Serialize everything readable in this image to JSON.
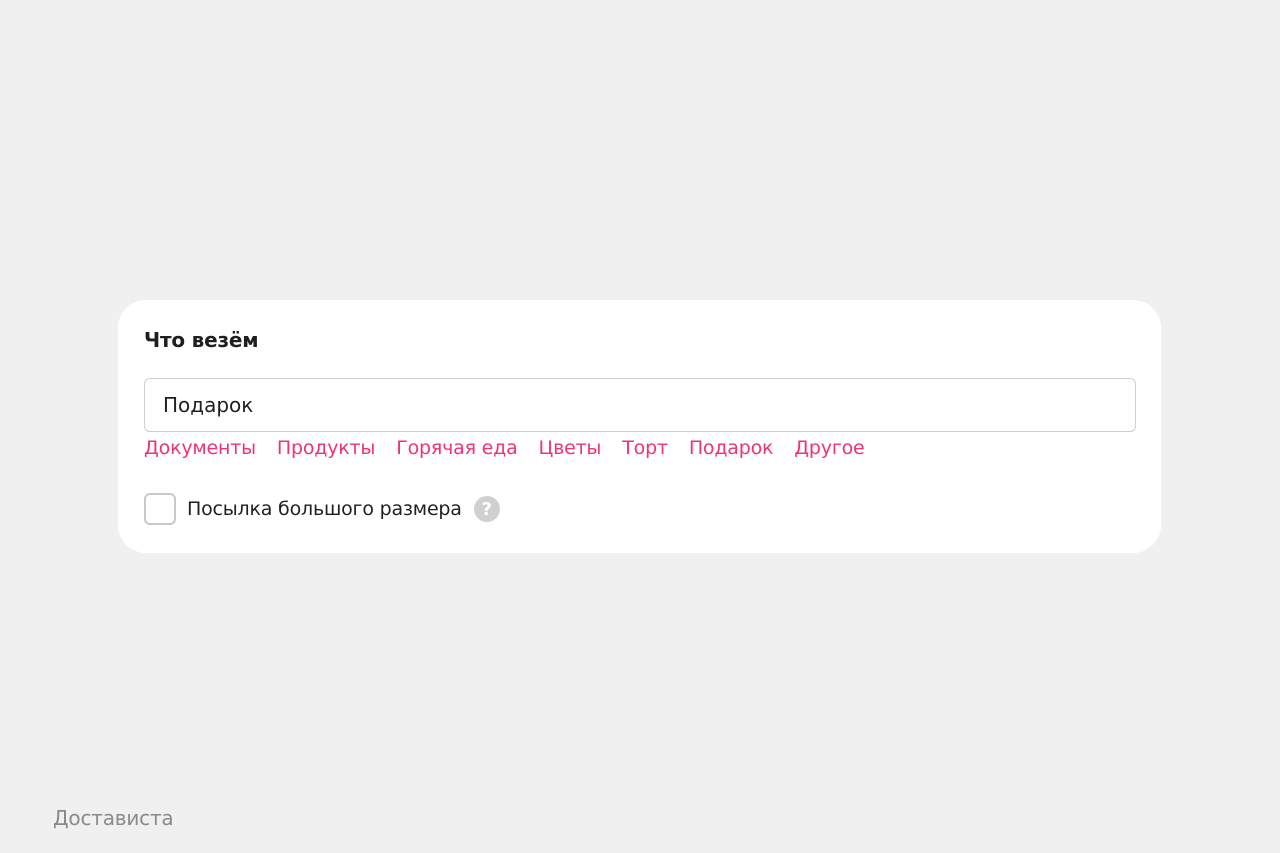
{
  "form": {
    "title": "Что везём",
    "input_value": "Подарок",
    "suggestions": [
      "Документы",
      "Продукты",
      "Горячая еда",
      "Цветы",
      "Торт",
      "Подарок",
      "Другое"
    ],
    "checkbox_label": "Посылка большого размера",
    "checkbox_checked": false,
    "help_icon_glyph": "?",
    "accent_color": "#f1327a"
  },
  "footer": {
    "brand": "Достависта"
  }
}
